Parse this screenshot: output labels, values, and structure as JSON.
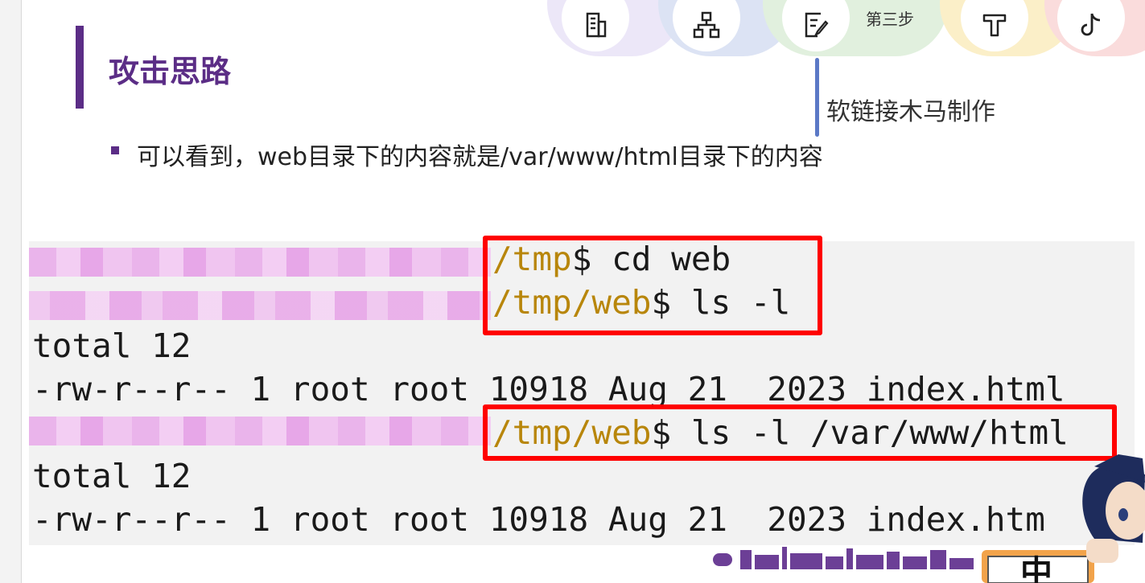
{
  "steps": {
    "current_step_label": "第三步",
    "callout": "软链接木马制作",
    "icons": [
      "building-icon",
      "org-chart-icon",
      "checklist-icon",
      "text-tool-icon",
      "tiktok-icon"
    ]
  },
  "heading": "攻击思路",
  "bullet": "可以看到，web目录下的内容就是/var/www/html目录下的内容",
  "terminal": {
    "lines": [
      {
        "path": "/tmp",
        "cmd": "$ cd web"
      },
      {
        "path": "/tmp/web",
        "cmd": "$ ls -l"
      },
      {
        "text": "total 12"
      },
      {
        "text": "-rw-r--r-- 1 root root 10918 Aug 21  2023 index.html"
      },
      {
        "path": "/tmp/web",
        "cmd": "$ ls -l /var/www/html"
      },
      {
        "text": "total 12"
      },
      {
        "text": "-rw-r--r-- 1 root root 10918 Aug 21  2023 index.htm"
      }
    ]
  },
  "colors": {
    "accent": "#5b2d86",
    "highlight": "#ff0000",
    "path": "#b8860b"
  },
  "mascot_sign": "中"
}
